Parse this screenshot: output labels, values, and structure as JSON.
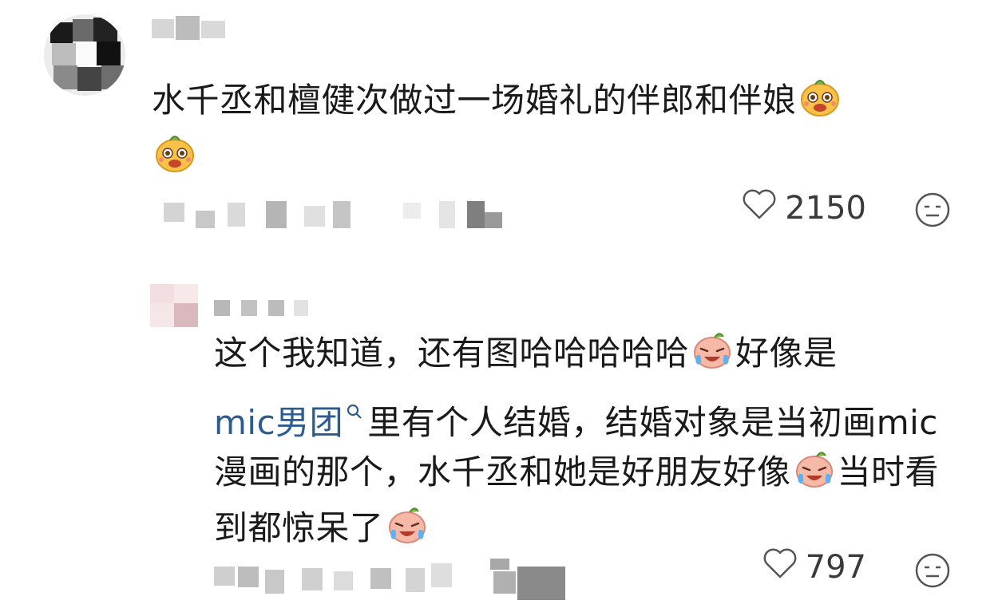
{
  "comments": [
    {
      "text_before": "水千丞和檀健次做过一场婚礼的伴郎和伴娘",
      "emoji_after": "doge-laugh-icon",
      "likes": "2150"
    },
    {
      "text_part1": "这个我知道，还有图哈哈哈哈哈",
      "text_part2": "好像是",
      "topic": "mic男团",
      "text_part3": "里有个人结婚，结婚对象是当初画mic漫画的那个，水千丞和她是好朋友好像",
      "text_part4": "当时看到都惊呆了",
      "likes": "797"
    }
  ],
  "colors": {
    "text": "#1a1a1a",
    "topic": "#2b5c8f",
    "meta": "#3a3a3a"
  }
}
